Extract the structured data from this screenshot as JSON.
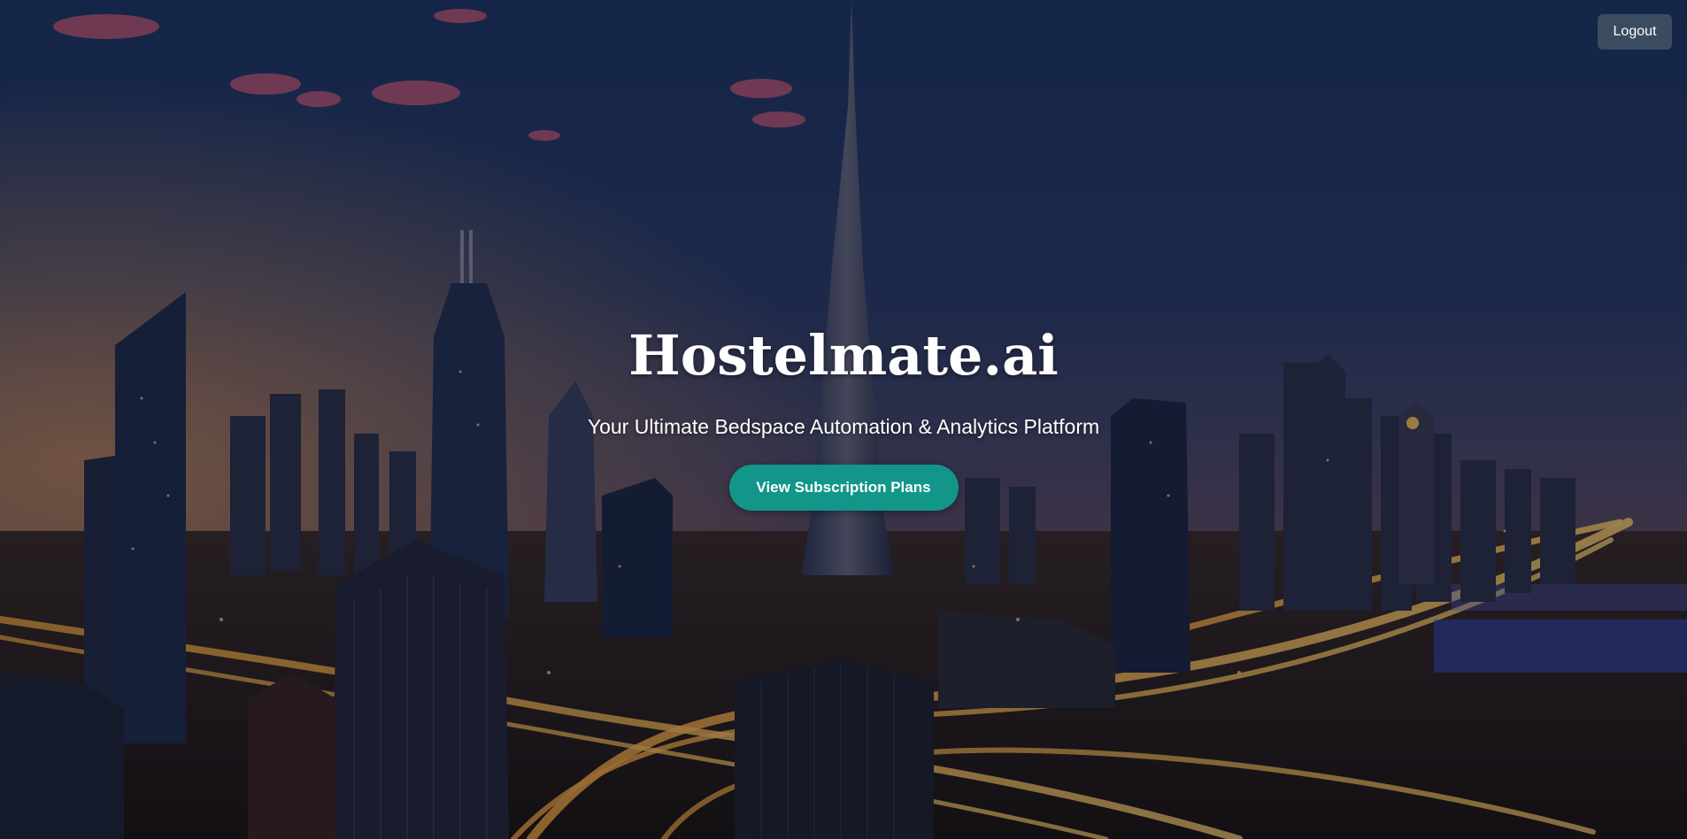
{
  "header": {
    "logout_label": "Logout"
  },
  "hero": {
    "title": "Hostelmate.ai",
    "subtitle": "Your Ultimate Bedspace Automation & Analytics Platform",
    "cta_label": "View Subscription Plans"
  },
  "colors": {
    "cta_background": "#12968a",
    "logout_background": "#3b4b60",
    "text": "#ffffff"
  },
  "background": {
    "icon": "city-skyline-night-photo"
  }
}
